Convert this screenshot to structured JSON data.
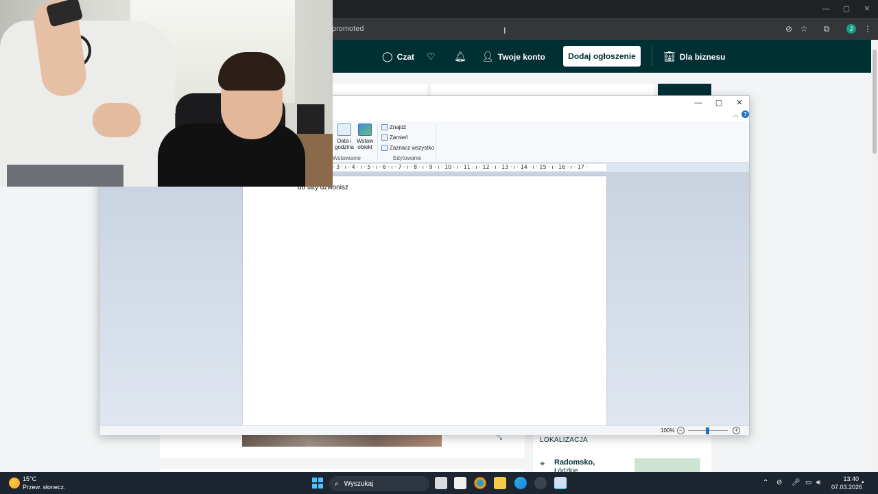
{
  "browser": {
    "url_fragment": "promoted",
    "profile_initial": "J"
  },
  "site_header": {
    "chat": "Czat",
    "account": "Twoje konto",
    "add_listing": "Dodaj ogłoszenie",
    "business": "Dla biznesu"
  },
  "listing": {
    "location_title": "LOKALIZACJA",
    "city": "Radomsko,",
    "region": "Łódzkie"
  },
  "wordpad": {
    "ribbon": {
      "date_time": "Data i godzina",
      "insert_object": "Wstaw obiekt",
      "insert_group": "Wstawianie",
      "find": "Znajdź",
      "replace": "Zamień",
      "select_all": "Zaznacz wszystko",
      "edit_group": "Edytowanie"
    },
    "ruler": "· 3 · ı · 4 · ı · 5 · ı · 6 · ı · 7 · ı · 8 · ı · 9 · ı · 10 · ı · 11 · ı · 12 · ı · 13 · ı · 14 · ı · 15 · ı · 16 · ı · 17 ·",
    "document_text": "do taty dzwonisz",
    "zoom": "100%",
    "zoom_level": 0.5
  },
  "taskbar": {
    "temperature": "15°C",
    "weather": "Przew. słonecz.",
    "search": "Wyszukaj",
    "time": "13:40",
    "date": "07.03.2026"
  }
}
